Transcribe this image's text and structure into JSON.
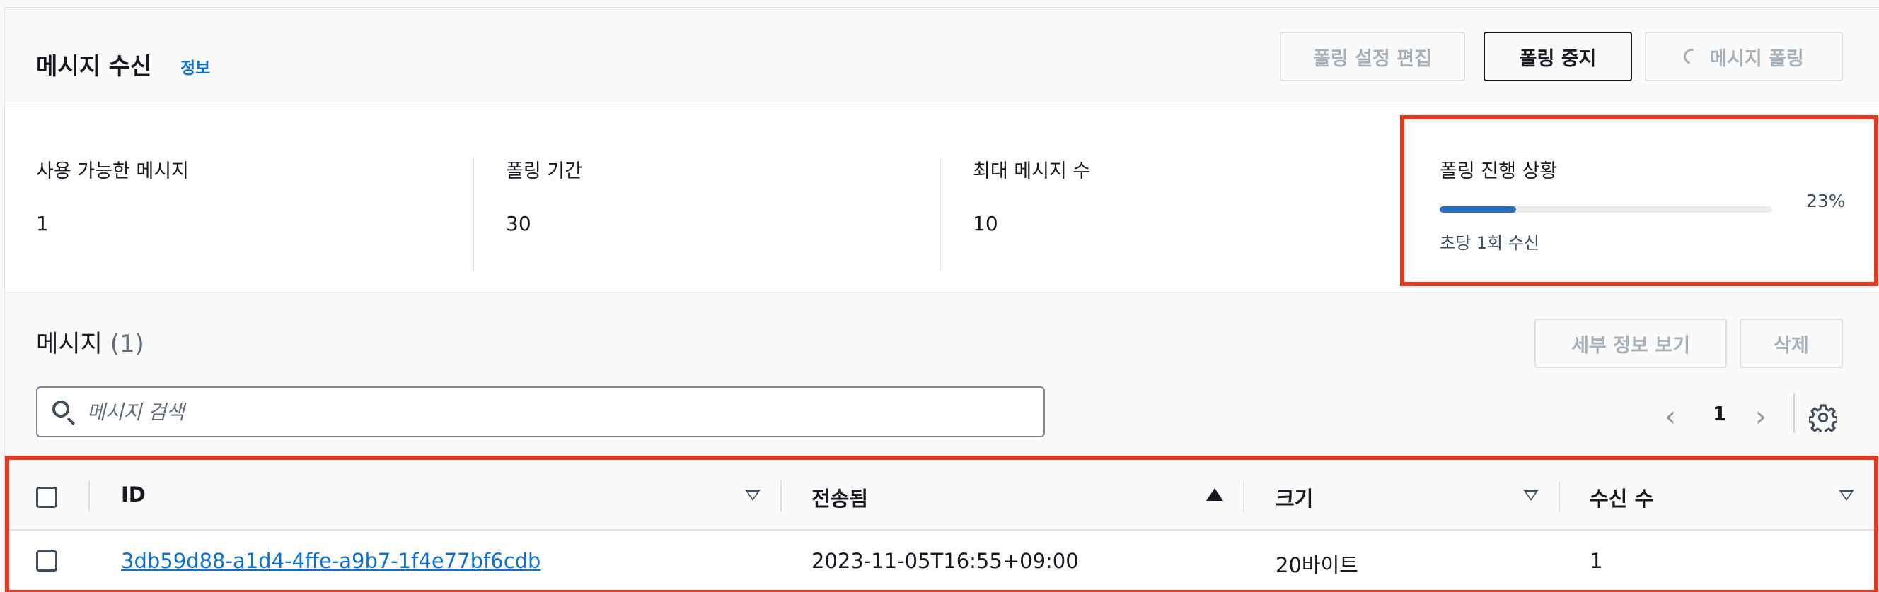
{
  "header": {
    "title": "메시지 수신",
    "info_link": "정보",
    "buttons": {
      "edit_polling": "폴링 설정 편집",
      "stop_polling": "폴링 중지",
      "poll_messages": "메시지 폴링"
    }
  },
  "stats": {
    "available": {
      "label": "사용 가능한 메시지",
      "value": "1"
    },
    "duration": {
      "label": "폴링 기간",
      "value": "30"
    },
    "max_messages": {
      "label": "최대 메시지 수",
      "value": "10"
    },
    "progress": {
      "label": "폴링 진행 상황",
      "percent_text": "23%",
      "fraction": 0.23,
      "description": "초당 1회 수신"
    }
  },
  "messages": {
    "title": "메시지",
    "count": "(1)",
    "buttons": {
      "details": "세부 정보 보기",
      "delete": "삭제"
    },
    "search": {
      "placeholder": "메시지 검색"
    },
    "pagination": {
      "prev": "‹",
      "page": "1",
      "next": "›"
    },
    "table": {
      "columns": [
        "ID",
        "전송됨",
        "크기",
        "수신 수"
      ],
      "rows": [
        {
          "id": "3db59d88-a1d4-4ffe-a9b7-1f4e77bf6cdb",
          "sent": "2023-11-05T16:55+09:00",
          "size": "20바이트",
          "receive_count": "1"
        }
      ]
    }
  },
  "colors": {
    "accent": "#0972d3",
    "progress": "#2a6db8",
    "highlight": "#e5391e"
  },
  "icons": [
    "search-icon",
    "gear-icon",
    "spinner-icon",
    "sort-down-icon",
    "sort-up-icon",
    "chevron-left-icon",
    "chevron-right-icon"
  ]
}
